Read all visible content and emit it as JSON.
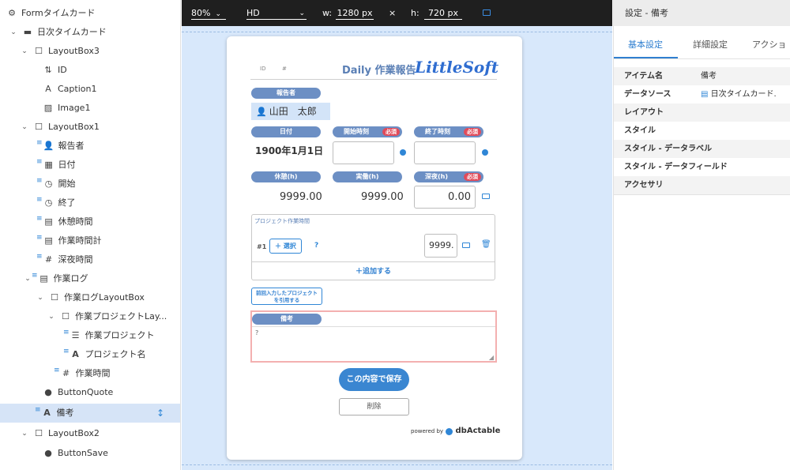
{
  "tree": {
    "items": [
      {
        "label": "Formタイムカード",
        "icon": "gear-icon"
      },
      {
        "label": "日次タイムカード",
        "icon": "form-icon"
      },
      {
        "label": "LayoutBox3",
        "icon": "box-icon"
      },
      {
        "label": "ID",
        "icon": "sort-icon"
      },
      {
        "label": "Caption1",
        "icon": "text-icon"
      },
      {
        "label": "Image1",
        "icon": "image-icon"
      },
      {
        "label": "LayoutBox1",
        "icon": "box-icon"
      },
      {
        "label": "報告者",
        "icon": "person-icon"
      },
      {
        "label": "日付",
        "icon": "calendar-icon"
      },
      {
        "label": "開始",
        "icon": "clock-icon"
      },
      {
        "label": "終了",
        "icon": "clock-icon"
      },
      {
        "label": "休憩時間",
        "icon": "calculator-icon"
      },
      {
        "label": "作業時間計",
        "icon": "calculator-icon"
      },
      {
        "label": "深夜時間",
        "icon": "hash-icon"
      },
      {
        "label": "作業ログ",
        "icon": "list-icon"
      },
      {
        "label": "作業ログLayoutBox",
        "icon": "box-icon"
      },
      {
        "label": "作業プロジェクトLay...",
        "icon": "box-icon"
      },
      {
        "label": "作業プロジェクト",
        "icon": "database-icon"
      },
      {
        "label": "プロジェクト名",
        "icon": "text-icon"
      },
      {
        "label": "作業時間",
        "icon": "hash-icon"
      },
      {
        "label": "ButtonQuote",
        "icon": "play-icon"
      },
      {
        "label": "備考",
        "icon": "text-icon"
      },
      {
        "label": "LayoutBox2",
        "icon": "box-icon"
      },
      {
        "label": "ButtonSave",
        "icon": "play-icon"
      }
    ]
  },
  "toolbar": {
    "zoom": "80%",
    "resolution": "HD",
    "width_label": "w:",
    "width_value": "1280 px",
    "times": "×",
    "height_label": "h:",
    "height_value": "720 px"
  },
  "form": {
    "id_label": "ID",
    "id_hash": "#",
    "title": "Daily 作業報告",
    "logo": "LittleSoft",
    "reporter_label": "報告者",
    "reporter_name": "山田　太郎",
    "date_label": "日付",
    "date_value": "1900年1月1日",
    "start_label": "開始時刻",
    "end_label": "終了時刻",
    "required": "必須",
    "break_label": "休憩(h)",
    "actual_label": "実働(h)",
    "night_label": "深夜(h)",
    "break_value": "9999.00",
    "actual_value": "9999.00",
    "night_value": "0.00",
    "project_section_label": "プロジェクト作業時間",
    "row_number": "#1",
    "select_button": "＋ 選択",
    "question": "?",
    "project_hours": "9999.",
    "add_button": "＋追加する",
    "quote_button": "前回入力したプロジェクトを引用する",
    "remarks_label": "備考",
    "remarks_value": "?",
    "save_button": "この内容で保存",
    "delete_button": "削除",
    "powered_by": "powered by",
    "powered_brand": "dbActable"
  },
  "right_panel": {
    "title": "設定 - 備考",
    "tabs": [
      "基本設定",
      "詳細設定",
      "アクショ"
    ],
    "rows": [
      {
        "label": "アイテム名",
        "value": "備考"
      },
      {
        "label": "データソース",
        "value": "日次タイムカード."
      },
      {
        "label": "レイアウト",
        "value": ""
      },
      {
        "label": "スタイル",
        "value": ""
      },
      {
        "label": "スタイル - データラベル",
        "value": ""
      },
      {
        "label": "スタイル - データフィールド",
        "value": ""
      },
      {
        "label": "アクセサリ",
        "value": ""
      }
    ]
  },
  "colors": {
    "accent": "#2f86d6",
    "pill": "#6c8fc4",
    "required": "#e14b5a",
    "selection": "#d6e4f7",
    "canvas": "#d8e8fb"
  }
}
